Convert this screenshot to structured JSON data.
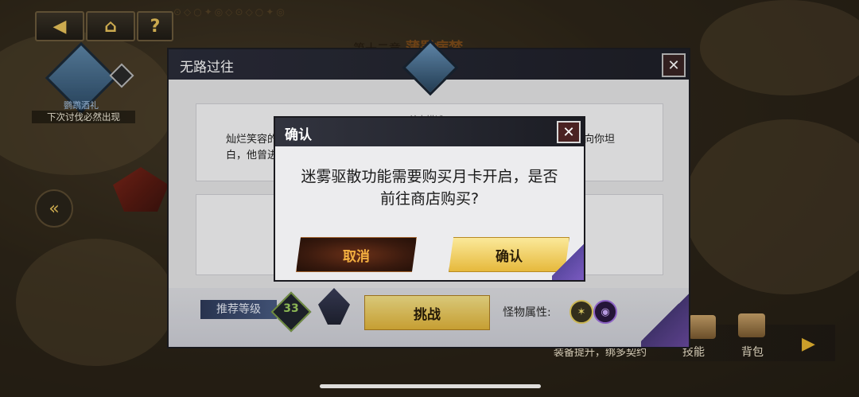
{
  "nav": {
    "back_icon": "arrow-left-icon",
    "home_icon": "home-icon",
    "help_label": "?"
  },
  "map": {
    "chapter_prefix": "第十二章",
    "chapter_name": "蒲署病梦"
  },
  "character": {
    "name": "鹦鹉酒礼",
    "note": "下次讨伐必然出现"
  },
  "bottom_bar": {
    "equip_text": "装备提升，绑多契约",
    "skill_label": "技能",
    "bag_label": "背包"
  },
  "stage_dialog": {
    "title": "无路过往",
    "close_label": "✕",
    "desc_title": "关卡描述",
    "desc_line1_start": "灿烂笑容的",
    "desc_line1_end": "向你坦",
    "desc_line2_start": "白，他曾进",
    "recommend_label": "推荐等级",
    "recommend_level": "33",
    "challenge_label": "挑战",
    "monster_attr_label": "怪物属性:"
  },
  "confirm_modal": {
    "title": "确认",
    "close_label": "✕",
    "message_line1": "迷雾驱散功能需要购买月卡开启，是否",
    "message_line2": "前往商店购买?",
    "cancel_label": "取消",
    "confirm_label": "确认"
  },
  "colors": {
    "gold_button": "#e6b93c",
    "dark_header": "#1b1c23",
    "level_green": "#9fd060"
  }
}
